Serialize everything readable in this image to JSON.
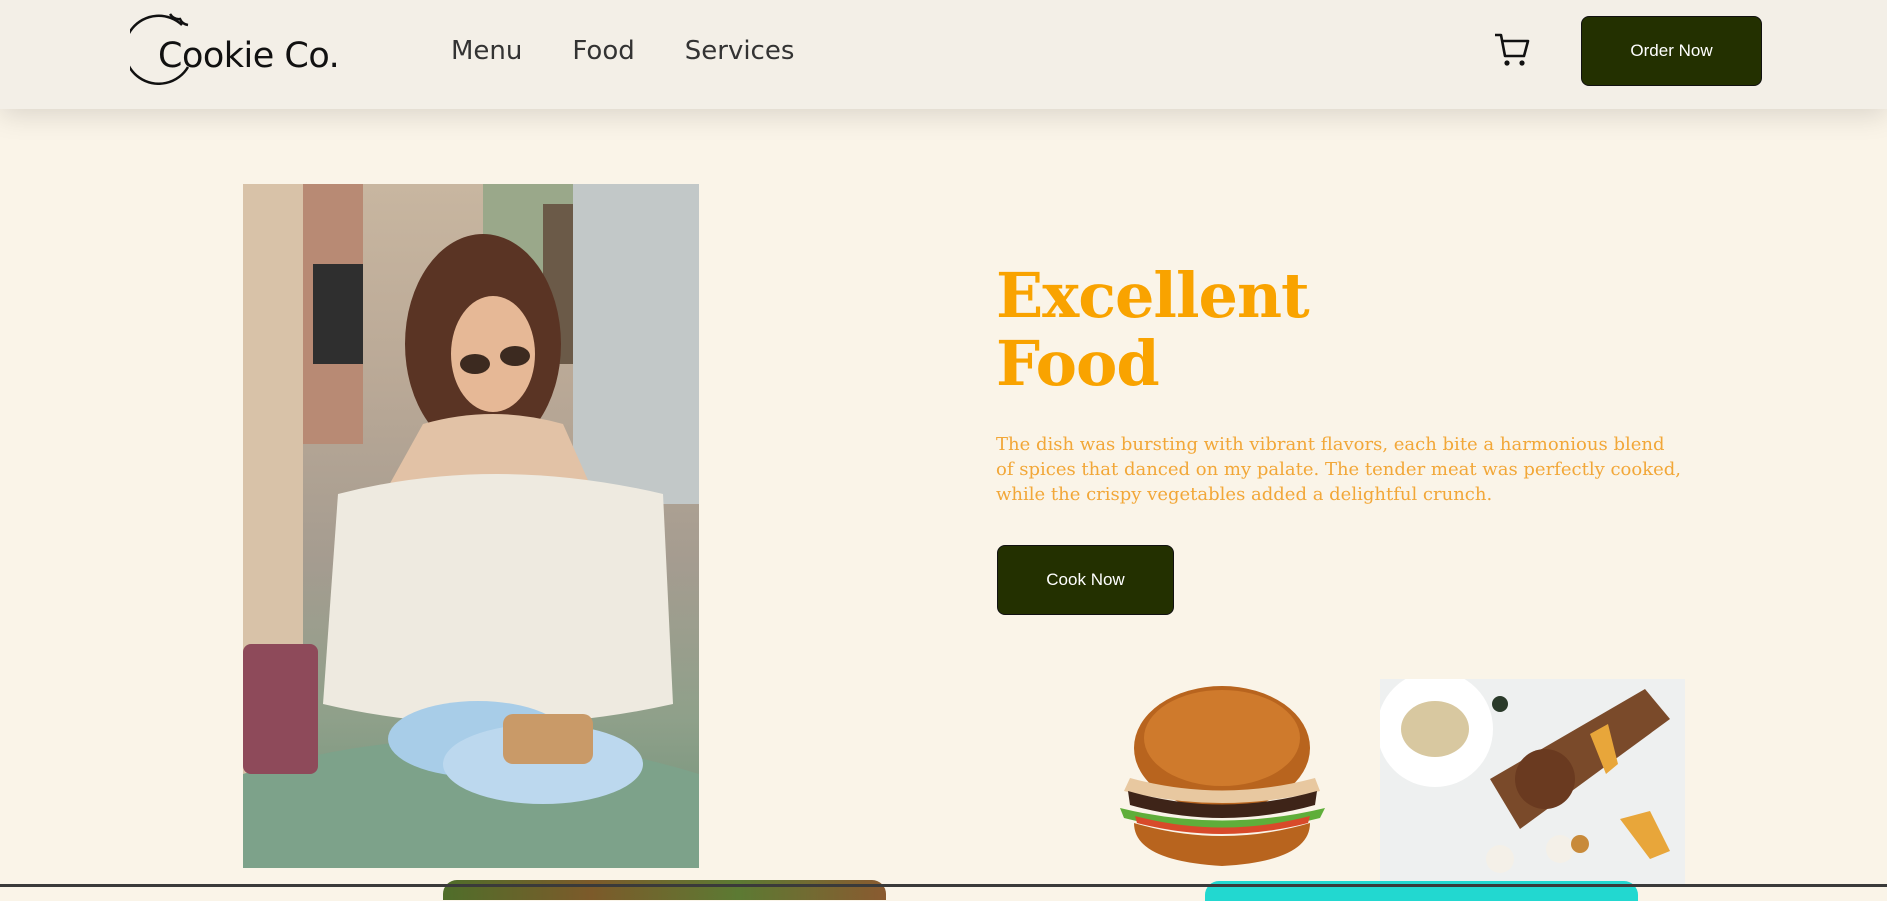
{
  "header": {
    "logo_text": "Cookie Co.",
    "nav": [
      "Menu",
      "Food",
      "Services"
    ],
    "cart_icon": "cart-icon",
    "order_button": "Order Now"
  },
  "hero": {
    "title_line1": "Excellent",
    "title_line2": "Food",
    "description": "The dish was bursting with vibrant flavors, each bite a harmonious blend of spices that danced on my palate. The tender meat was perfectly cooked, while the crispy vegetables added a delightful crunch.",
    "button": "Cook Now"
  },
  "colors": {
    "header_bg": "#f3efe7",
    "page_bg": "#faf4e8",
    "accent_orange": "#f9a300",
    "button_dark": "#233000"
  }
}
